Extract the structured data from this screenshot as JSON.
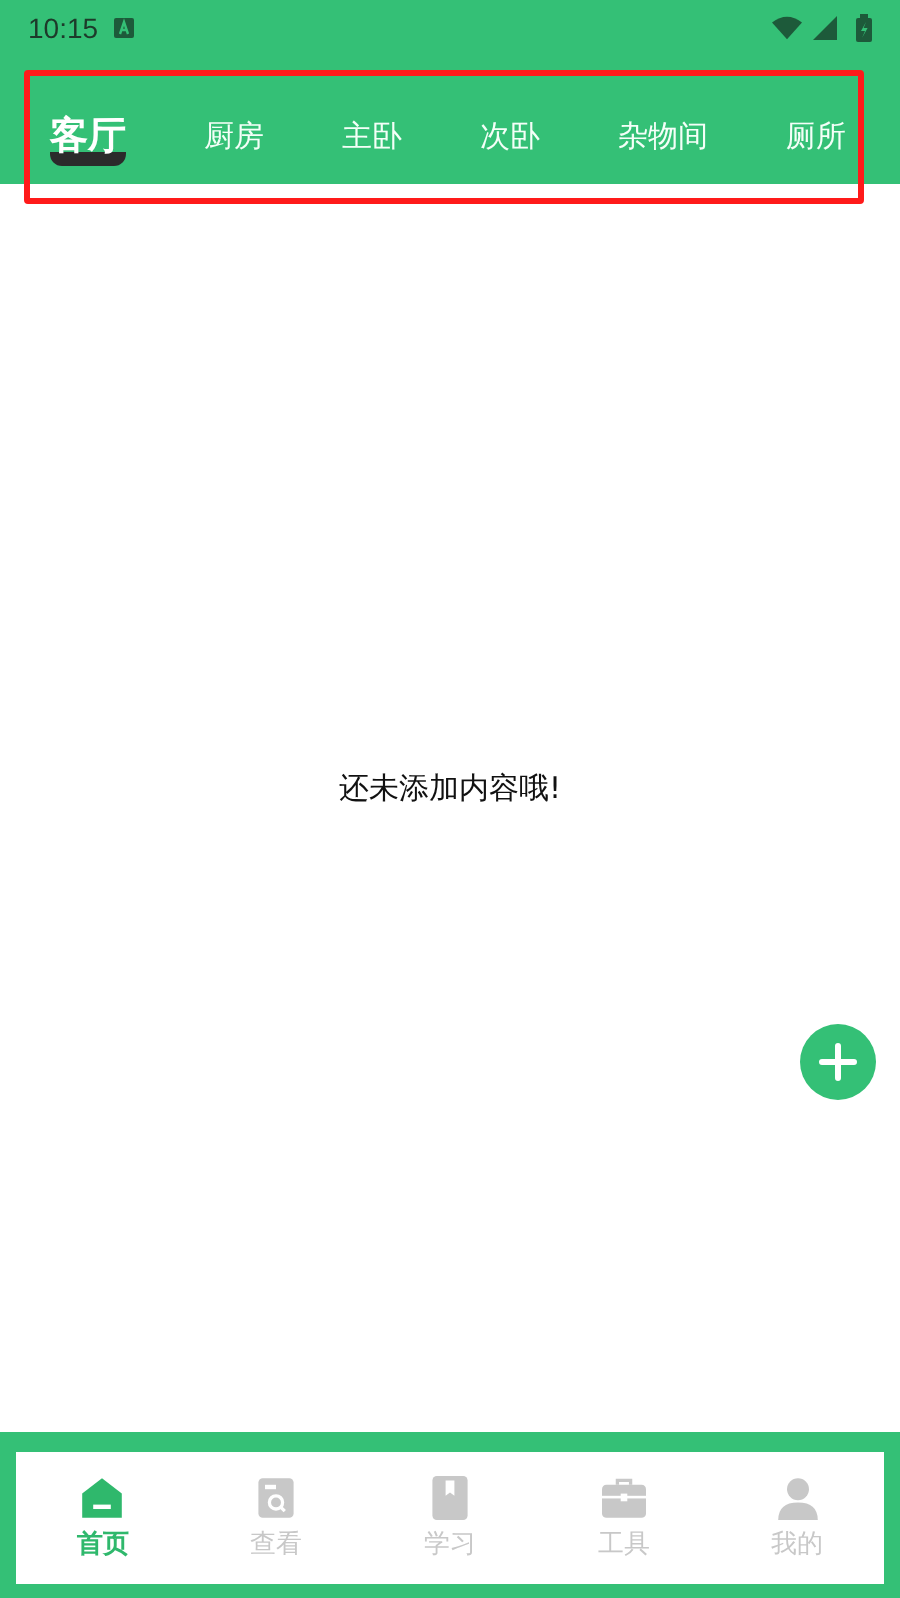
{
  "status_bar": {
    "time": "10:15"
  },
  "tabs": [
    {
      "label": "客厅",
      "selected": true
    },
    {
      "label": "厨房",
      "selected": false
    },
    {
      "label": "主卧",
      "selected": false
    },
    {
      "label": "次卧",
      "selected": false
    },
    {
      "label": "杂物间",
      "selected": false
    },
    {
      "label": "厕所",
      "selected": false
    }
  ],
  "empty_message": "还未添加内容哦!",
  "bottom_nav": [
    {
      "label": "首页",
      "kind": "home",
      "selected": true
    },
    {
      "label": "查看",
      "kind": "view",
      "selected": false
    },
    {
      "label": "学习",
      "kind": "study",
      "selected": false
    },
    {
      "label": "工具",
      "kind": "tools",
      "selected": false
    },
    {
      "label": "我的",
      "kind": "profile",
      "selected": false
    }
  ]
}
